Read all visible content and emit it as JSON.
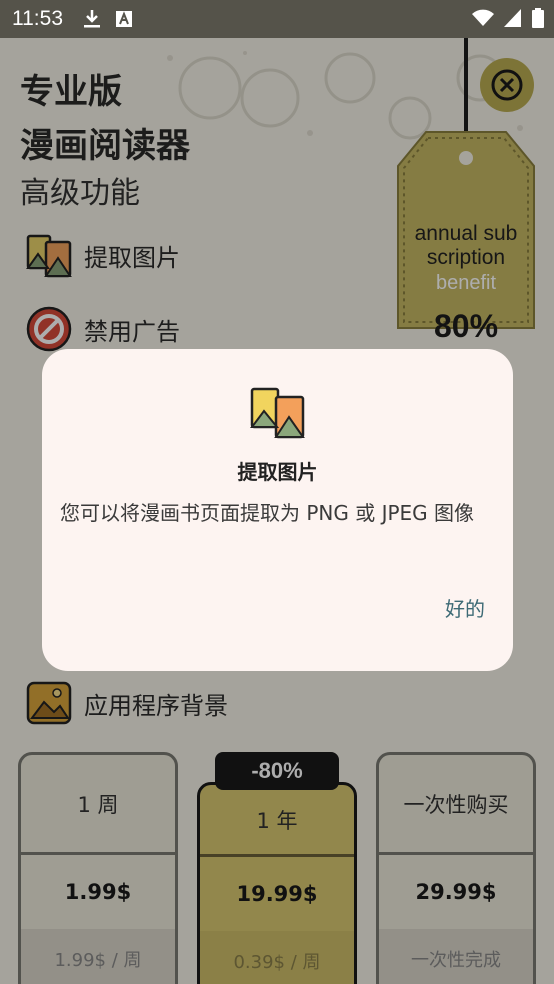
{
  "status_bar": {
    "time": "11:53"
  },
  "header": {
    "line1": "专业版",
    "line2": "漫画阅读器",
    "subtitle": "高级功能"
  },
  "price_tag": {
    "line1": "annual sub",
    "line2": "scription",
    "line3": "benefit",
    "percent": "80%"
  },
  "features": [
    {
      "label": "提取图片",
      "icon": "image-icon"
    },
    {
      "label": "禁用广告",
      "icon": "no-ads-icon"
    },
    {
      "label": "应用程序背景",
      "icon": "wallpaper-icon"
    }
  ],
  "plans": [
    {
      "period": "1 周",
      "price": "1.99$",
      "note": "1.99$ / 周"
    },
    {
      "period": "1 年",
      "price": "19.99$",
      "note": "0.39$ / 周",
      "badge": "-80%"
    },
    {
      "period": "一次性购买",
      "price": "29.99$",
      "note": "一次性完成"
    }
  ],
  "dialog": {
    "title": "提取图片",
    "body": "您可以将漫画书页面提取为 PNG 或 JPEG 图像",
    "ok": "好的"
  },
  "colors": {
    "accent": "#b9ab52",
    "dialog_button": "#3d6a75",
    "status_bar": "#55534a"
  }
}
